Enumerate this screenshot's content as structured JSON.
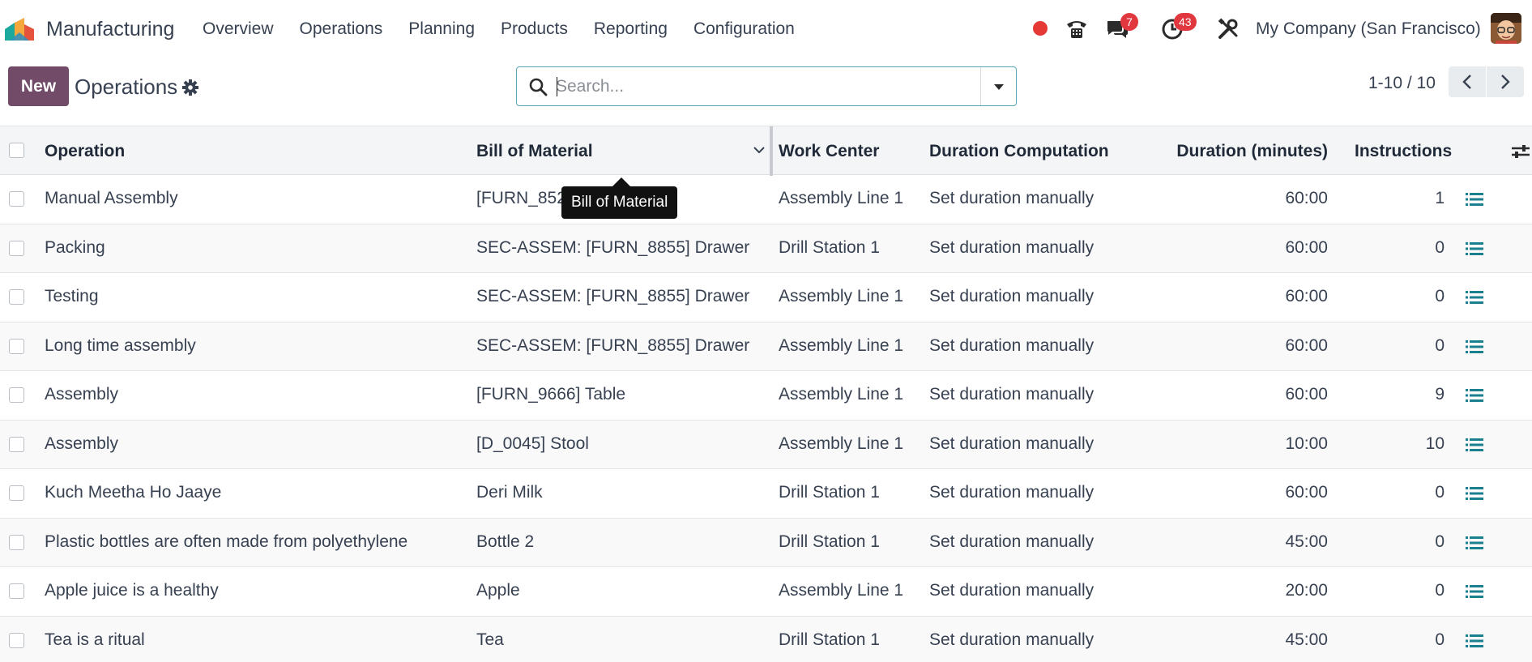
{
  "app": {
    "name": "Manufacturing"
  },
  "menu": [
    "Overview",
    "Operations",
    "Planning",
    "Products",
    "Reporting",
    "Configuration"
  ],
  "systray": {
    "chat_badge": "7",
    "activity_badge": "43",
    "company": "My Company (San Francisco)"
  },
  "control": {
    "new_label": "New",
    "title": "Operations",
    "search_placeholder": "Search...",
    "pager": "1-10 / 10"
  },
  "columns": {
    "operation": "Operation",
    "bom": "Bill of Material",
    "workcenter": "Work Center",
    "computation": "Duration Computation",
    "duration": "Duration (minutes)",
    "instructions": "Instructions"
  },
  "tooltip": "Bill of Material",
  "rows": [
    {
      "operation": "Manual Assembly",
      "bom": "[FURN_852",
      "workcenter": "Assembly Line 1",
      "computation": "Set duration manually",
      "duration": "60:00",
      "instructions": "1"
    },
    {
      "operation": "Packing",
      "bom": "SEC-ASSEM: [FURN_8855] Drawer",
      "workcenter": "Drill Station 1",
      "computation": "Set duration manually",
      "duration": "60:00",
      "instructions": "0"
    },
    {
      "operation": "Testing",
      "bom": "SEC-ASSEM: [FURN_8855] Drawer",
      "workcenter": "Assembly Line 1",
      "computation": "Set duration manually",
      "duration": "60:00",
      "instructions": "0"
    },
    {
      "operation": "Long time assembly",
      "bom": "SEC-ASSEM: [FURN_8855] Drawer",
      "workcenter": "Assembly Line 1",
      "computation": "Set duration manually",
      "duration": "60:00",
      "instructions": "0"
    },
    {
      "operation": "Assembly",
      "bom": "[FURN_9666] Table",
      "workcenter": "Assembly Line 1",
      "computation": "Set duration manually",
      "duration": "60:00",
      "instructions": "9"
    },
    {
      "operation": "Assembly",
      "bom": "[D_0045] Stool",
      "workcenter": "Assembly Line 1",
      "computation": "Set duration manually",
      "duration": "10:00",
      "instructions": "10"
    },
    {
      "operation": "Kuch Meetha Ho Jaaye",
      "bom": "Deri Milk",
      "workcenter": "Drill Station 1",
      "computation": "Set duration manually",
      "duration": "60:00",
      "instructions": "0"
    },
    {
      "operation": "Plastic bottles are often made from polyethylene",
      "bom": "Bottle 2",
      "workcenter": "Drill Station 1",
      "computation": "Set duration manually",
      "duration": "45:00",
      "instructions": "0"
    },
    {
      "operation": "Apple juice is a healthy",
      "bom": "Apple",
      "workcenter": "Assembly Line 1",
      "computation": "Set duration manually",
      "duration": "20:00",
      "instructions": "0"
    },
    {
      "operation": "Tea is a ritual",
      "bom": "Tea",
      "workcenter": "Drill Station 1",
      "computation": "Set duration manually",
      "duration": "45:00",
      "instructions": "0"
    }
  ]
}
